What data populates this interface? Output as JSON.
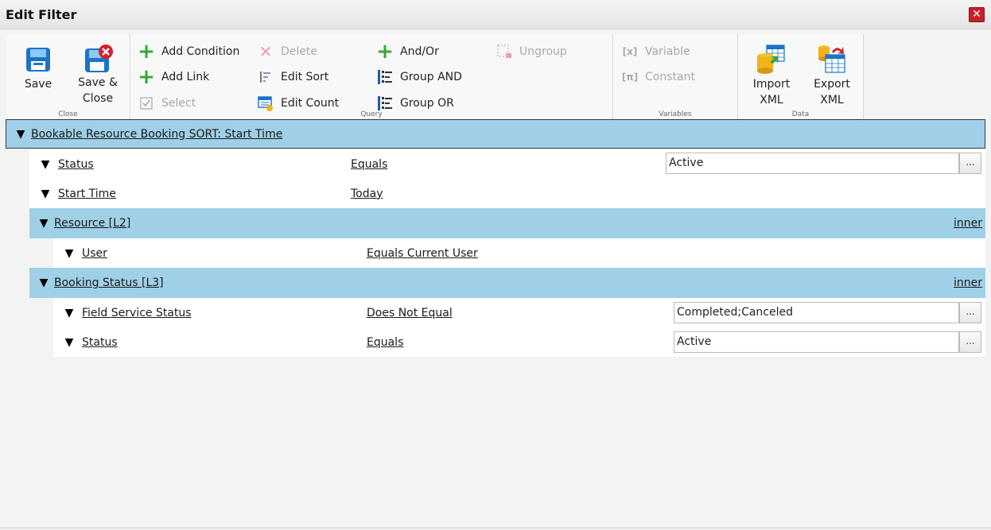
{
  "window": {
    "title": "Edit Filter"
  },
  "ribbon": {
    "close_group": {
      "label": "Close",
      "save": "Save",
      "save_close_line1": "Save &",
      "save_close_line2": "Close"
    },
    "query_group": {
      "label": "Query",
      "add_condition": "Add Condition",
      "add_link": "Add Link",
      "select": "Select",
      "delete": "Delete",
      "edit_sort": "Edit Sort",
      "edit_count": "Edit Count",
      "and_or": "And/Or",
      "group_and": "Group AND",
      "group_or": "Group OR",
      "ungroup": "Ungroup"
    },
    "variables_group": {
      "label": "Variables",
      "variable": "Variable",
      "constant": "Constant",
      "variable_glyph": "[x]",
      "constant_glyph": "[π]"
    },
    "data_group": {
      "label": "Data",
      "import_line1": "Import",
      "import_line2": "XML",
      "export_line1": "Export",
      "export_line2": "XML"
    }
  },
  "tree": {
    "entity": "Bookable Resource Booking SORT: Start Time",
    "conditions": [
      {
        "field": "Status",
        "operator": "Equals",
        "value": "Active"
      },
      {
        "field": "Start Time",
        "operator": "Today"
      }
    ],
    "links": [
      {
        "name": "Resource [L2]",
        "join": "inner",
        "conditions": [
          {
            "field": "User",
            "operator": "Equals Current User"
          }
        ]
      },
      {
        "name": "Booking Status [L3]",
        "join": "inner",
        "conditions": [
          {
            "field": "Field Service Status",
            "operator": "Does Not Equal",
            "value": "Completed;Canceled"
          },
          {
            "field": "Status",
            "operator": "Equals",
            "value": "Active"
          }
        ]
      }
    ],
    "ellipsis": "...",
    "expand_glyph": "▼"
  },
  "colors": {
    "header_blue": "#9fd0e8",
    "add_green": "#37a83a",
    "close_red": "#c8202a"
  }
}
